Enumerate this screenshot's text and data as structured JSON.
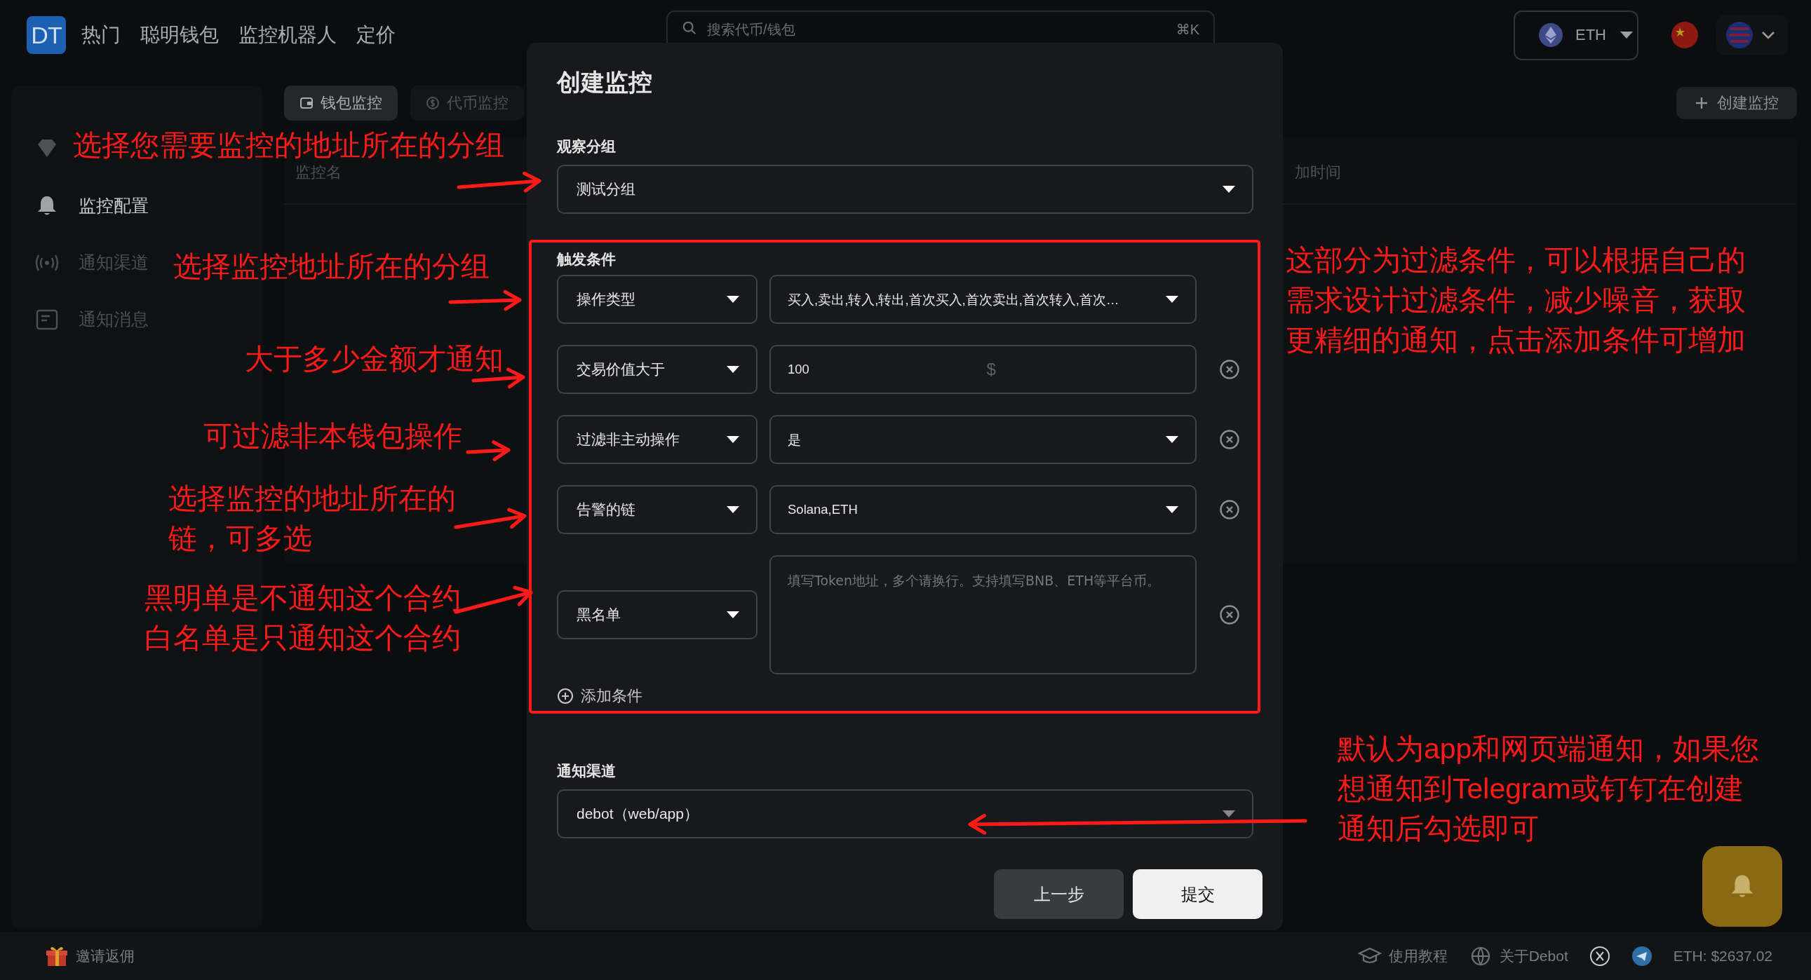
{
  "top_bar": {
    "logo": "DT",
    "nav": [
      "热门",
      "聪明钱包",
      "监控机器人",
      "定价"
    ],
    "search": {
      "placeholder": "搜索代币/钱包",
      "shortcut": "⌘K"
    },
    "network": "ETH"
  },
  "sidebar": {
    "items": [
      {
        "selected": false
      },
      {
        "label": "监控配置",
        "selected": true
      },
      {
        "label": "通知渠道",
        "selected": false
      },
      {
        "label": "通知消息",
        "selected": false
      }
    ]
  },
  "tabs": [
    {
      "label": "钱包监控",
      "selected": true
    },
    {
      "label": "代币监控",
      "selected": false
    }
  ],
  "create_button": "创建监控",
  "table": {
    "columns": [
      "监控名",
      "加时间"
    ]
  },
  "modal": {
    "title": "创建监控",
    "group": {
      "label": "观察分组",
      "value": "测试分组"
    },
    "conditions": {
      "label": "触发条件",
      "add": "添加条件",
      "rows": [
        {
          "field": "操作类型",
          "kind": "select",
          "value": "买入,卖出,转入,转出,首次买入,首次卖出,首次转入,首次…",
          "removable": false
        },
        {
          "field": "交易价值大于",
          "kind": "amount",
          "value": "100",
          "suffix": "$",
          "removable": true
        },
        {
          "field": "过滤非主动操作",
          "kind": "select",
          "value": "是",
          "removable": true
        },
        {
          "field": "告警的链",
          "kind": "select",
          "value": "Solana,ETH",
          "removable": true
        },
        {
          "field": "黑名单",
          "kind": "textarea",
          "placeholder": "填写Token地址，多个请换行。支持填写BNB、ETH等平台币。",
          "removable": true
        }
      ]
    },
    "channel": {
      "label": "通知渠道",
      "value": "debot（web/app）"
    },
    "buttons": [
      {
        "label": "上一步",
        "kind": "secondary"
      },
      {
        "label": "提交",
        "kind": "primary"
      }
    ]
  },
  "footer": {
    "invite": "邀请返佣",
    "links": [
      "使用教程",
      "关于Debot"
    ],
    "price": "ETH: $2637.02"
  },
  "annotations": [
    {
      "lines": [
        "选择您需要监控的地址所在的分组"
      ]
    },
    {
      "lines": [
        "选择监控地址所在的分组"
      ]
    },
    {
      "lines": [
        "大于多少金额才通知"
      ]
    },
    {
      "lines": [
        "可过滤非本钱包操作"
      ]
    },
    {
      "lines": [
        "选择监控的地址所在的",
        "链，可多选"
      ]
    },
    {
      "lines": [
        "黑明单是不通知这个合约",
        "白名单是只通知这个合约"
      ]
    },
    {
      "lines": [
        "这部分为过滤条件，可以根据自己的",
        "需求设计过滤条件，减少噪音，获取",
        "更精细的通知，点击添加条件可增加"
      ]
    },
    {
      "lines": [
        "默认为app和网页端通知，如果您",
        "想通知到Telegram或钉钉在创建",
        "通知后勾选即可"
      ]
    }
  ]
}
